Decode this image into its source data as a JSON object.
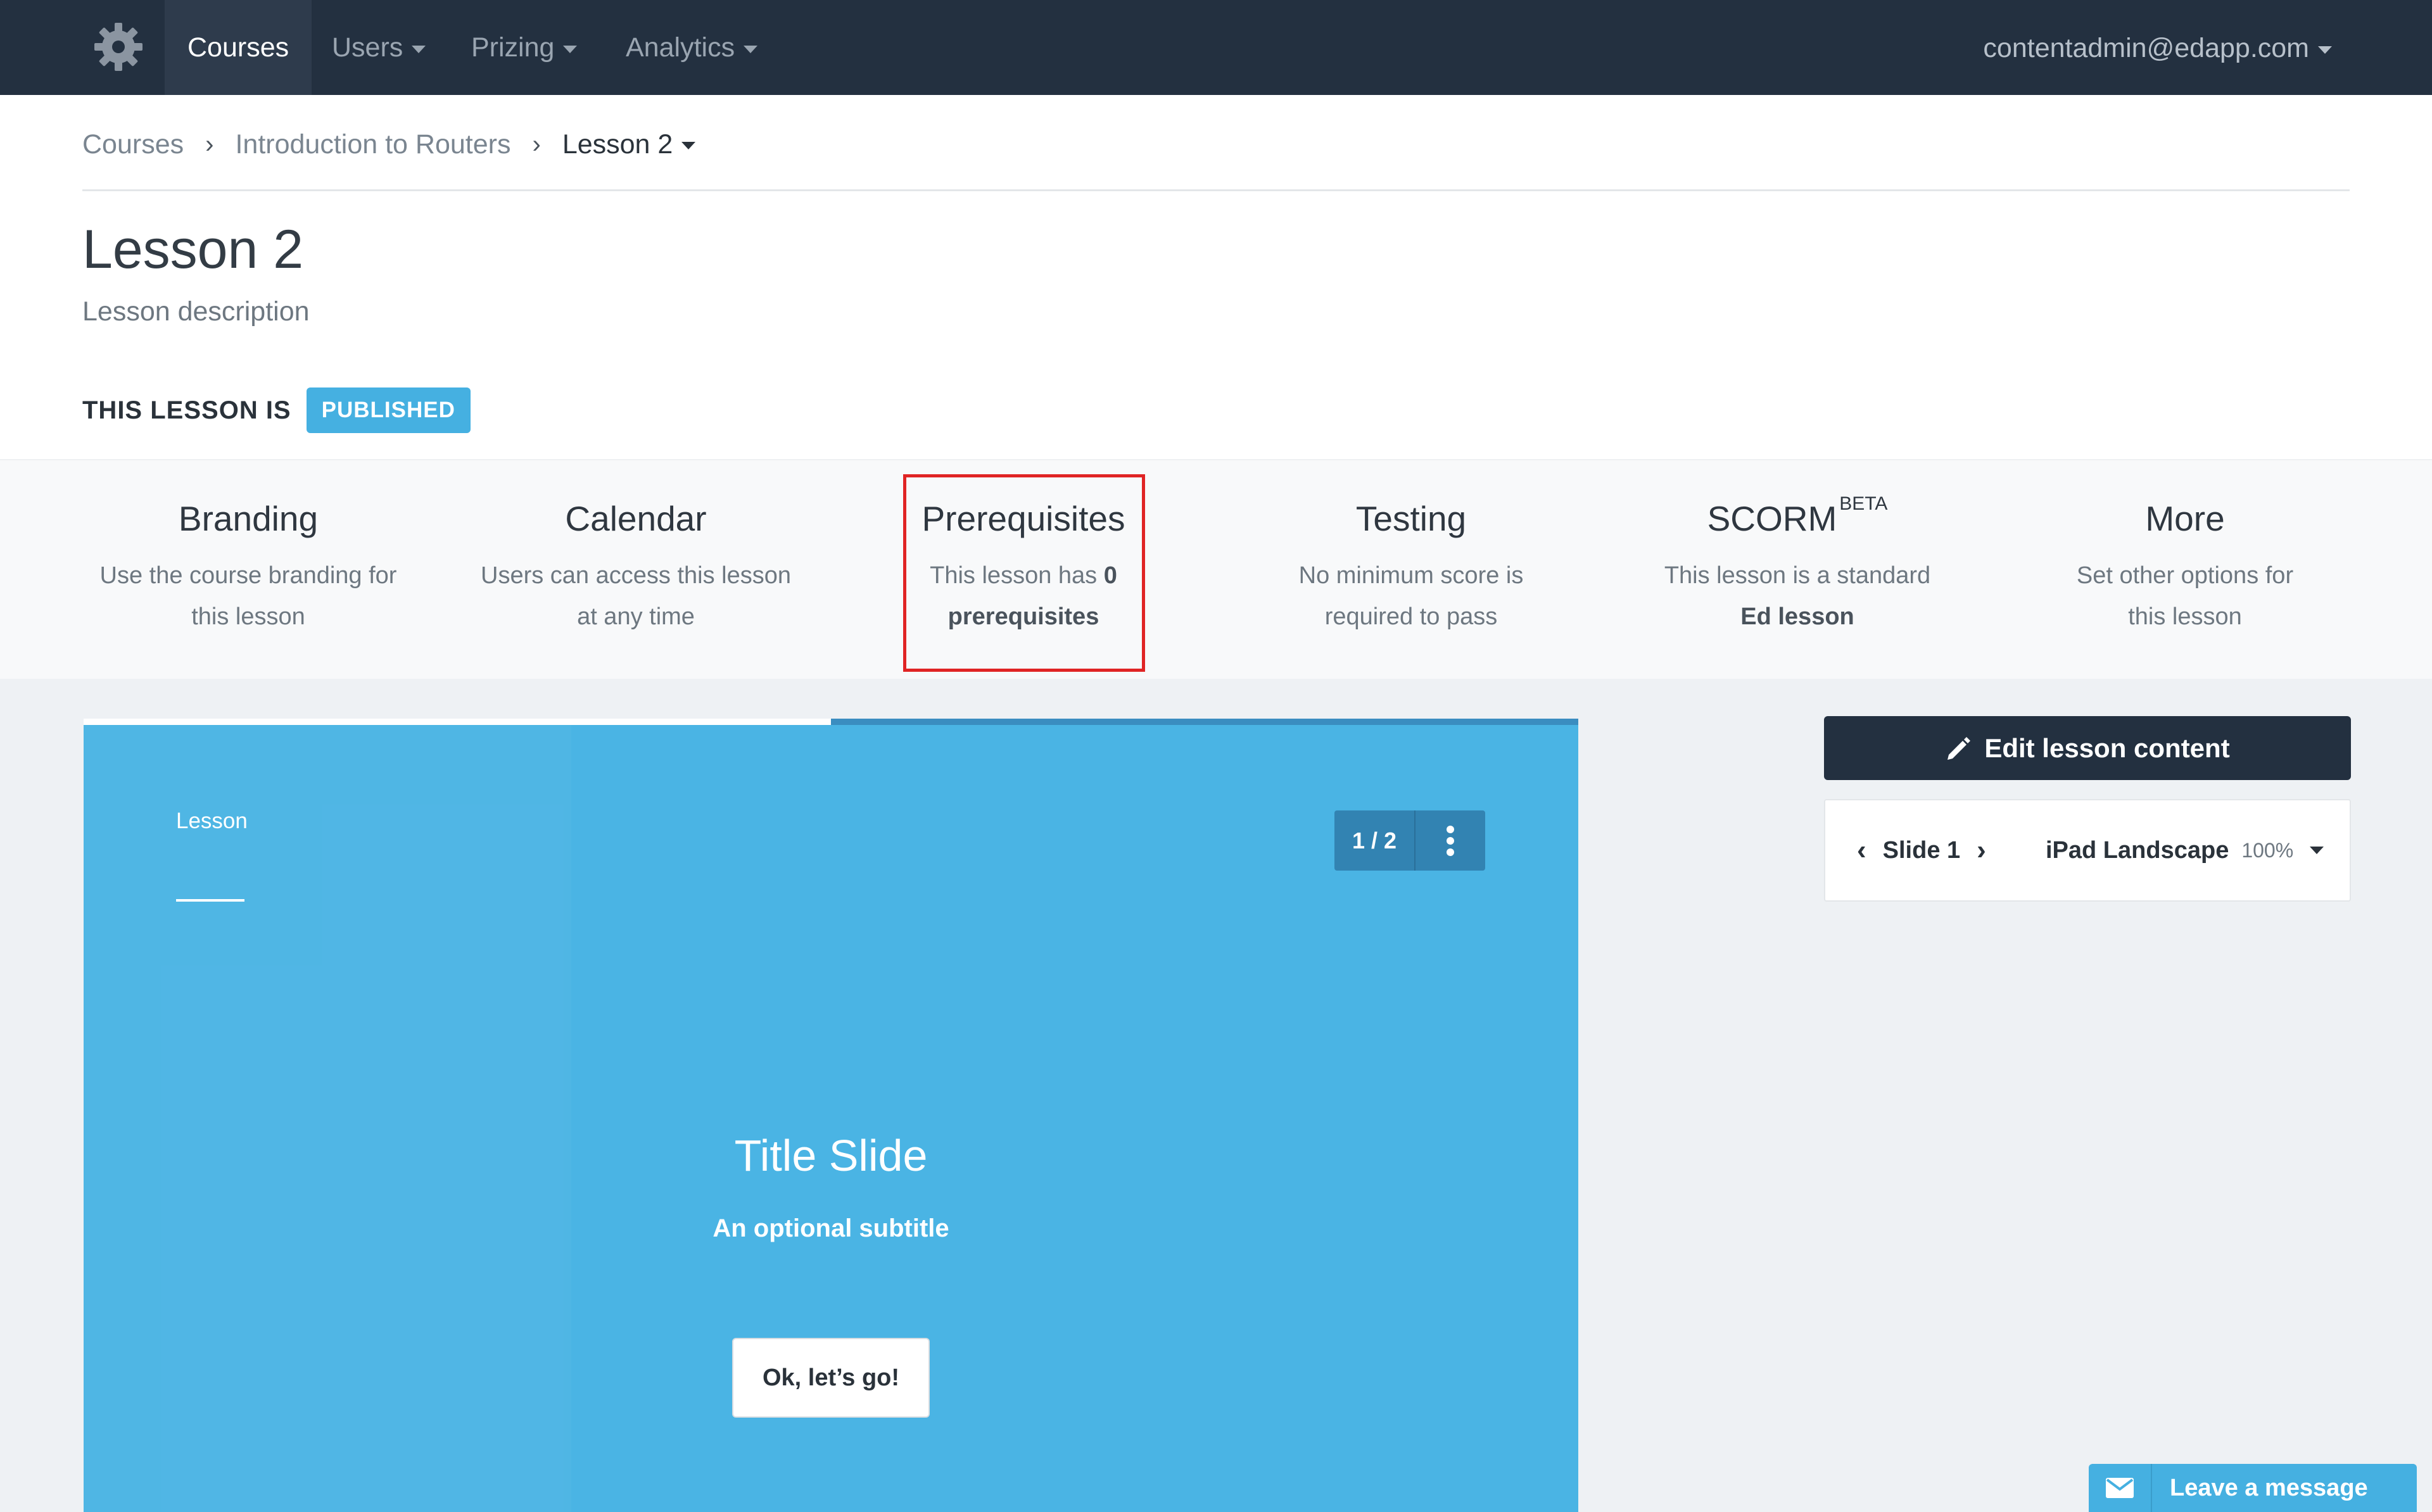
{
  "nav": {
    "items": [
      {
        "label": "Courses",
        "active": true
      },
      {
        "label": "Users"
      },
      {
        "label": "Prizing"
      },
      {
        "label": "Analytics"
      }
    ],
    "user_email": "contentadmin@edapp.com"
  },
  "breadcrumb": {
    "items": [
      "Courses",
      "Introduction to Routers"
    ],
    "current": "Lesson 2",
    "separator": "›"
  },
  "lesson": {
    "title": "Lesson 2",
    "description": "Lesson description",
    "status_label": "THIS LESSON IS",
    "status_badge": "PUBLISHED"
  },
  "settings": [
    {
      "title": "Branding",
      "line1": "Use the course branding for",
      "line2": "this lesson"
    },
    {
      "title": "Calendar",
      "line1": "Users can access this lesson",
      "line2": "at any time"
    },
    {
      "title": "Prerequisites",
      "line1_pre": "This lesson has",
      "line1_bold": "0",
      "line2": "prerequisites",
      "highlighted": true
    },
    {
      "title": "Testing",
      "line1": "No minimum score is",
      "line2": "required to pass"
    },
    {
      "title": "SCORM",
      "sup": "BETA",
      "line1": "This lesson is a standard",
      "line2": "Ed lesson"
    },
    {
      "title": "More",
      "line1": "Set other options for",
      "line2": "this lesson"
    }
  ],
  "preview": {
    "label": "Lesson",
    "counter": "1 / 2",
    "title": "Title Slide",
    "subtitle": "An optional subtitle",
    "cta": "Ok, let’s go!",
    "progress_fraction": 0.5
  },
  "panel": {
    "edit_label": "Edit lesson content",
    "slide_label": "Slide 1",
    "device_label": "iPad Landscape",
    "zoom": "100%"
  },
  "chat": {
    "label": "Leave a message"
  },
  "colors": {
    "navbar": "#233040",
    "accent": "#45b0e1",
    "slide_bg": "#4ab4e4",
    "highlight": "#e02424"
  }
}
